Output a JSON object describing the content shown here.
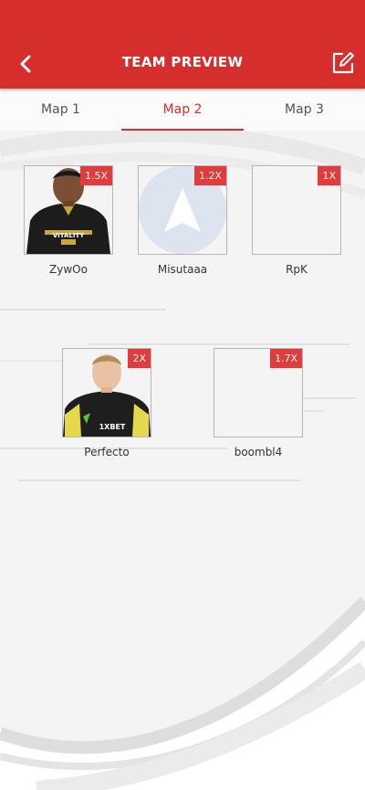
{
  "header": {
    "title": "TEAM PREVIEW",
    "bg_color": "#d62d2d"
  },
  "tabs": [
    {
      "label": "Map 1",
      "active": false
    },
    {
      "label": "Map 2",
      "active": true
    },
    {
      "label": "Map 3",
      "active": false
    }
  ],
  "players": [
    {
      "name": "ZywOo",
      "multiplier": "1.5X",
      "avatar": "player-photo"
    },
    {
      "name": "Misutaaa",
      "multiplier": "1.2X",
      "avatar": "default-arrow-avatar"
    },
    {
      "name": "RpK",
      "multiplier": "1X",
      "avatar": "empty"
    },
    {
      "name": "Perfecto",
      "multiplier": "2X",
      "avatar": "player-photo"
    },
    {
      "name": "boombl4",
      "multiplier": "1.7X",
      "avatar": "empty"
    }
  ],
  "icons": {
    "back": "back-arrow-icon",
    "edit": "edit-icon"
  }
}
